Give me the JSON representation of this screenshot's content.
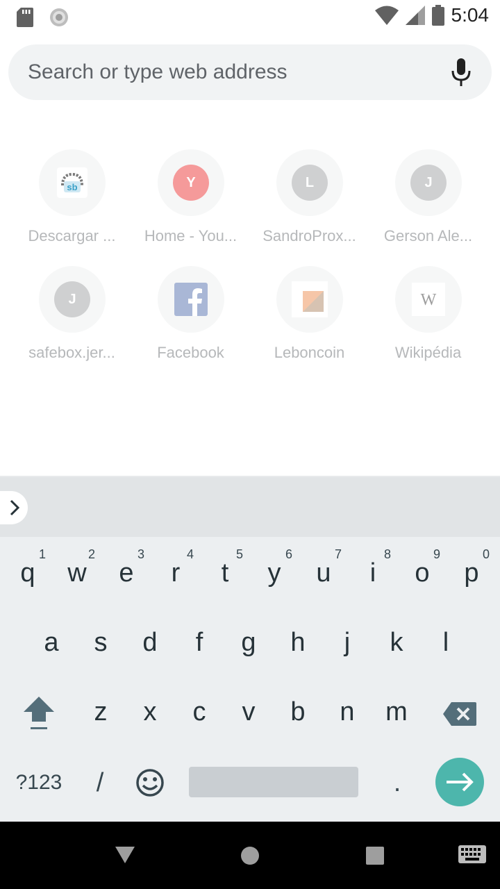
{
  "status": {
    "time": "5:04"
  },
  "search": {
    "placeholder": "Search or type web address"
  },
  "tiles": [
    {
      "label": "Descargar ...",
      "letter": "",
      "icon": "sb-logo-icon"
    },
    {
      "label": "Home - You...",
      "letter": "Y",
      "color": "#f59a9a"
    },
    {
      "label": "SandroProx...",
      "letter": "L",
      "color": "#cfd0d1"
    },
    {
      "label": "Gerson Ale...",
      "letter": "J",
      "color": "#cfd0d1"
    },
    {
      "label": "safebox.jer...",
      "letter": "J",
      "color": "#cfd0d1"
    },
    {
      "label": "Facebook",
      "letter": "",
      "icon": "facebook-icon"
    },
    {
      "label": "Leboncoin",
      "letter": "",
      "icon": "leboncoin-icon"
    },
    {
      "label": "Wikipédia",
      "letter": "",
      "icon": "wikipedia-icon"
    }
  ],
  "keyboard": {
    "row1": [
      {
        "k": "q",
        "h": "1"
      },
      {
        "k": "w",
        "h": "2"
      },
      {
        "k": "e",
        "h": "3"
      },
      {
        "k": "r",
        "h": "4"
      },
      {
        "k": "t",
        "h": "5"
      },
      {
        "k": "y",
        "h": "6"
      },
      {
        "k": "u",
        "h": "7"
      },
      {
        "k": "i",
        "h": "8"
      },
      {
        "k": "o",
        "h": "9"
      },
      {
        "k": "p",
        "h": "0"
      }
    ],
    "row2": [
      "a",
      "s",
      "d",
      "f",
      "g",
      "h",
      "j",
      "k",
      "l"
    ],
    "row3": [
      "z",
      "x",
      "c",
      "v",
      "b",
      "n",
      "m"
    ],
    "symbols_label": "?123",
    "slash": "/",
    "period": "."
  },
  "colors": {
    "enter_button": "#4db6ac",
    "facebook": "#3b5998"
  }
}
